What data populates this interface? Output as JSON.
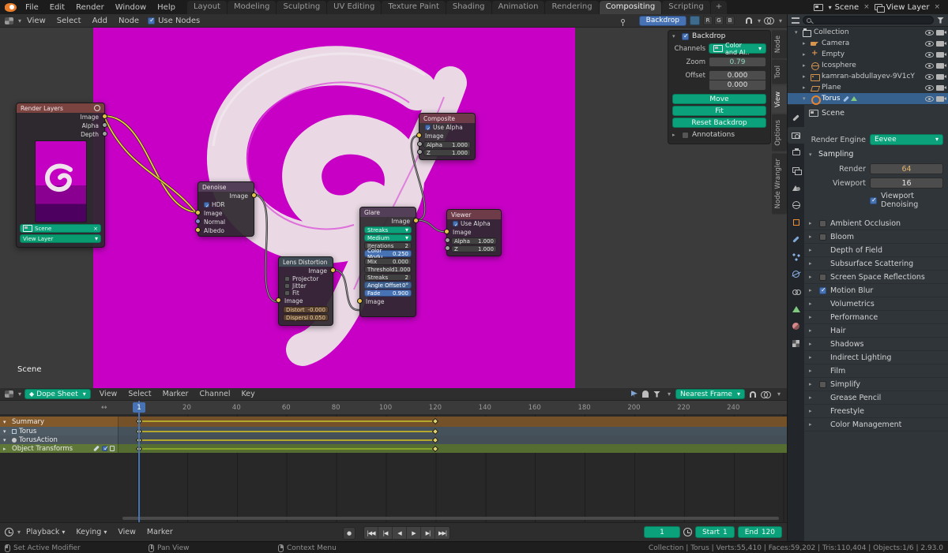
{
  "colors": {
    "accent_teal": "#0aa17b",
    "accent_blue": "#4772b3",
    "backdrop_magenta": "#c800c6"
  },
  "topbar": {
    "menus": [
      "File",
      "Edit",
      "Render",
      "Window",
      "Help"
    ],
    "tabs": [
      {
        "label": "Layout",
        "state": ""
      },
      {
        "label": "Modeling",
        "state": ""
      },
      {
        "label": "Sculpting",
        "state": ""
      },
      {
        "label": "UV Editing",
        "state": ""
      },
      {
        "label": "Texture Paint",
        "state": ""
      },
      {
        "label": "Shading",
        "state": ""
      },
      {
        "label": "Animation",
        "state": ""
      },
      {
        "label": "Rendering",
        "state": ""
      },
      {
        "label": "Compositing",
        "state": "active"
      },
      {
        "label": "Scripting",
        "state": ""
      }
    ],
    "add_tab": "+",
    "scene_selector": "Scene",
    "view_layer_selector": "View Layer"
  },
  "node_editor": {
    "header": {
      "menus": [
        "View",
        "Select",
        "Add",
        "Node"
      ],
      "use_nodes_label": "Use Nodes",
      "use_nodes_state": "on",
      "backdrop_label": "Backdrop",
      "channel_buttons": [
        "R",
        "G",
        "B"
      ]
    },
    "scene_label": "Scene",
    "nodes": {
      "render_layers": {
        "title": "Render Layers",
        "outputs": [
          {
            "label": "Image",
            "t": "img"
          },
          {
            "label": "Alpha",
            "t": "gray"
          },
          {
            "label": "Depth",
            "t": "gray"
          }
        ],
        "scene": "Scene",
        "view_layer": "View Layer"
      },
      "denoise": {
        "title": "Denoise",
        "output": "Image",
        "hdr_label": "HDR",
        "hdr_state": "on",
        "inputs": [
          {
            "label": "Image",
            "t": "img"
          },
          {
            "label": "Normal",
            "t": "vec"
          },
          {
            "label": "Albedo",
            "t": "img"
          }
        ]
      },
      "lens_distortion": {
        "title": "Lens Distortion",
        "output": "Image",
        "options": [
          {
            "label": "Projector",
            "state": "off"
          },
          {
            "label": "Jitter",
            "state": "off"
          },
          {
            "label": "Fit",
            "state": "off"
          }
        ],
        "input": "Image",
        "fields": [
          {
            "label": "Distort",
            "value": "-0.000",
            "state": "warm"
          },
          {
            "label": "Dispersi",
            "value": "0.050",
            "state": "warm"
          }
        ]
      },
      "glare": {
        "title": "Glare",
        "output": "Image",
        "dropdowns": [
          "Streaks",
          "Medium"
        ],
        "fields": [
          {
            "label": "Iterations",
            "value": "2",
            "state": ""
          },
          {
            "label": "Color Modu",
            "value": "0.250",
            "state": "hl"
          },
          {
            "label": "Mix",
            "value": "0.000",
            "state": ""
          },
          {
            "label": "Threshold",
            "value": "1.000",
            "state": ""
          },
          {
            "label": "Streaks",
            "value": "2",
            "state": ""
          },
          {
            "label": "Angle Offset",
            "value": "0°",
            "state": "hl2"
          },
          {
            "label": "Fade",
            "value": "0.900",
            "state": "hl"
          }
        ],
        "input": "Image"
      },
      "composite": {
        "title": "Composite",
        "use_alpha": "Use Alpha",
        "use_alpha_state": "on",
        "input": "Image",
        "fields": [
          {
            "label": "Alpha",
            "value": "1.000"
          },
          {
            "label": "Z",
            "value": "1.000"
          }
        ]
      },
      "viewer": {
        "title": "Viewer",
        "use_alpha": "Use Alpha",
        "use_alpha_state": "on",
        "input": "Image",
        "fields": [
          {
            "label": "Alpha",
            "value": "1.000"
          },
          {
            "label": "Z",
            "value": "1.000"
          }
        ]
      }
    },
    "sidebar": {
      "tabs": [
        {
          "label": "Node",
          "state": ""
        },
        {
          "label": "Tool",
          "state": ""
        },
        {
          "label": "View",
          "state": "active"
        },
        {
          "label": "Options",
          "state": ""
        },
        {
          "label": "Node Wrangler",
          "state": ""
        }
      ],
      "backdrop": {
        "title": "Backdrop",
        "title_state": "on",
        "channels_label": "Channels",
        "channels_value": "Color and Al..",
        "zoom_label": "Zoom",
        "zoom_value": "0.79",
        "offset_label": "Offset",
        "offset_x": "0.000",
        "offset_y": "0.000",
        "move": "Move",
        "fit": "Fit",
        "reset": "Reset Backdrop",
        "annotations": "Annotations",
        "annotations_state": "off"
      }
    }
  },
  "outliner": {
    "rows": [
      {
        "label": "Collection",
        "icon": "collection",
        "arrow": "▾",
        "state": "",
        "depth": 0
      },
      {
        "label": "Camera",
        "icon": "camera",
        "arrow": "▸",
        "state": "",
        "depth": 1
      },
      {
        "label": "Empty",
        "icon": "empty",
        "arrow": "▸",
        "state": "",
        "depth": 1
      },
      {
        "label": "Icosphere",
        "icon": "sphere",
        "arrow": "▸",
        "state": "",
        "depth": 1
      },
      {
        "label": "kamran-abdullayev-9V1cY",
        "icon": "image",
        "arrow": "▸",
        "state": "",
        "depth": 1
      },
      {
        "label": "Plane",
        "icon": "plane",
        "arrow": "▸",
        "state": "",
        "depth": 1
      },
      {
        "label": "Torus",
        "icon": "torus",
        "arrow": "▾",
        "state": "selected",
        "depth": 1
      }
    ]
  },
  "properties": {
    "breadcrumb": "Scene",
    "render_engine_label": "Render Engine",
    "render_engine_value": "Eevee",
    "sampling": {
      "title": "Sampling",
      "render_label": "Render",
      "render_value": "64",
      "viewport_label": "Viewport",
      "viewport_value": "16",
      "denoise_label": "Viewport Denoising",
      "denoise_state": "on"
    },
    "sections": [
      {
        "label": "Ambient Occlusion",
        "cb": "off"
      },
      {
        "label": "Bloom",
        "cb": "off"
      },
      {
        "label": "Depth of Field",
        "cb": "none"
      },
      {
        "label": "Subsurface Scattering",
        "cb": "none"
      },
      {
        "label": "Screen Space Reflections",
        "cb": "off"
      },
      {
        "label": "Motion Blur",
        "cb": "on"
      },
      {
        "label": "Volumetrics",
        "cb": "none"
      },
      {
        "label": "Performance",
        "cb": "none"
      },
      {
        "label": "Hair",
        "cb": "none"
      },
      {
        "label": "Shadows",
        "cb": "none"
      },
      {
        "label": "Indirect Lighting",
        "cb": "none"
      },
      {
        "label": "Film",
        "cb": "none"
      },
      {
        "label": "Simplify",
        "cb": "off"
      },
      {
        "label": "Grease Pencil",
        "cb": "none"
      },
      {
        "label": "Freestyle",
        "cb": "none"
      },
      {
        "label": "Color Management",
        "cb": "none"
      }
    ]
  },
  "dopesheet": {
    "header": {
      "mode": "Dope Sheet",
      "menus": [
        "View",
        "Select",
        "Marker",
        "Channel",
        "Key"
      ],
      "snap": "Nearest Frame"
    },
    "ruler_ticks": [
      "20",
      "40",
      "60",
      "80",
      "100",
      "120",
      "140",
      "160",
      "180",
      "200",
      "220",
      "240"
    ],
    "current_frame": "1",
    "channels": [
      {
        "label": "Summary"
      },
      {
        "label": "Torus"
      },
      {
        "label": "TorusAction"
      },
      {
        "label": "Object Transforms"
      }
    ],
    "keyframes": {
      "start": 1,
      "end": 120
    }
  },
  "playbar": {
    "menus": [
      "Playback",
      "Keying",
      "View",
      "Marker"
    ],
    "record_glyph": "●",
    "buttons": [
      {
        "name": "jump-to-start",
        "glyph": "|◀◀"
      },
      {
        "name": "jump-to-prev-keyframe",
        "glyph": "|◀"
      },
      {
        "name": "play-reverse",
        "glyph": "◀"
      },
      {
        "name": "play",
        "glyph": "▶"
      },
      {
        "name": "jump-to-next-keyframe",
        "glyph": "▶|"
      },
      {
        "name": "jump-to-end",
        "glyph": "▶▶|"
      }
    ],
    "frame": "1",
    "start_label": "Start",
    "start_value": "1",
    "end_label": "End",
    "end_value": "120"
  },
  "statusbar": {
    "left": "Set Active Modifier",
    "mid1": "Pan View",
    "mid2": "Context Menu",
    "right": "Collection | Torus | Verts:55,410 | Faces:59,202 | Tris:110,404 | Objects:1/6 | 2.93.0"
  }
}
